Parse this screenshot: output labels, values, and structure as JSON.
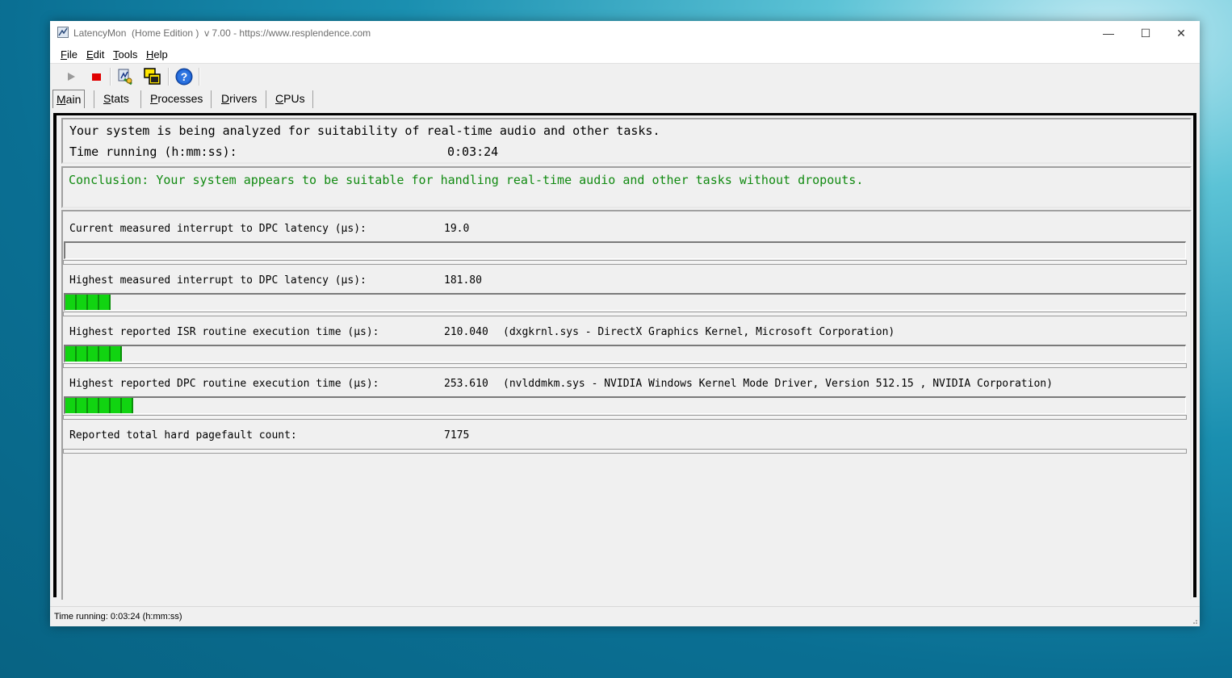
{
  "window": {
    "title": "LatencyMon  (Home Edition )  v 7.00 - https://www.resplendence.com",
    "minimize_glyph": "—",
    "maximize_glyph": "☐",
    "close_glyph": "✕"
  },
  "menu": [
    {
      "hotkey": "F",
      "rest": "ile"
    },
    {
      "hotkey": "E",
      "rest": "dit"
    },
    {
      "hotkey": "T",
      "rest": "ools"
    },
    {
      "hotkey": "H",
      "rest": "elp"
    }
  ],
  "toolbar": {
    "icons": [
      "play-icon",
      "stop-icon",
      "analyze-icon",
      "windows-icon",
      "help-icon"
    ],
    "colors": {
      "stop": "#e00000",
      "help": "#1b5fcf"
    }
  },
  "tabs": [
    {
      "hotkey": "M",
      "rest": "ain"
    },
    {
      "hotkey": "S",
      "rest": "tats"
    },
    {
      "hotkey": "P",
      "rest": "rocesses"
    },
    {
      "hotkey": "D",
      "rest": "rivers"
    },
    {
      "hotkey": "C",
      "rest": "PUs"
    }
  ],
  "main": {
    "status_line": "Your system is being analyzed for suitability of real-time audio and other tasks.",
    "time_label": "Time running (h:mm:ss):",
    "time_value": "0:03:24",
    "conclusion": "Conclusion: Your system appears to be suitable for handling real-time audio and other tasks without dropouts.",
    "conclusion_color": "#118a11",
    "metrics": [
      {
        "label": "Current measured interrupt to DPC latency (µs):",
        "value": "19.0",
        "detail": "",
        "bar_level": 0
      },
      {
        "label": "Highest measured interrupt to DPC latency (µs):",
        "value": "181.80",
        "detail": "",
        "bar_level": 4
      },
      {
        "label": "Highest reported ISR routine execution time (µs):",
        "value": "210.040",
        "detail": "(dxgkrnl.sys - DirectX Graphics Kernel, Microsoft Corporation)",
        "bar_level": 5
      },
      {
        "label": "Highest reported DPC routine execution time (µs):",
        "value": "253.610",
        "detail": "(nvlddmkm.sys - NVIDIA Windows Kernel Mode Driver, Version 512.15 , NVIDIA Corporation)",
        "bar_level": 6
      },
      {
        "label": "Reported total hard pagefault count:",
        "value": "7175",
        "detail": "",
        "bar_level": null
      }
    ]
  },
  "statusbar": {
    "text": "Time running: 0:03:24  (h:mm:ss)"
  }
}
